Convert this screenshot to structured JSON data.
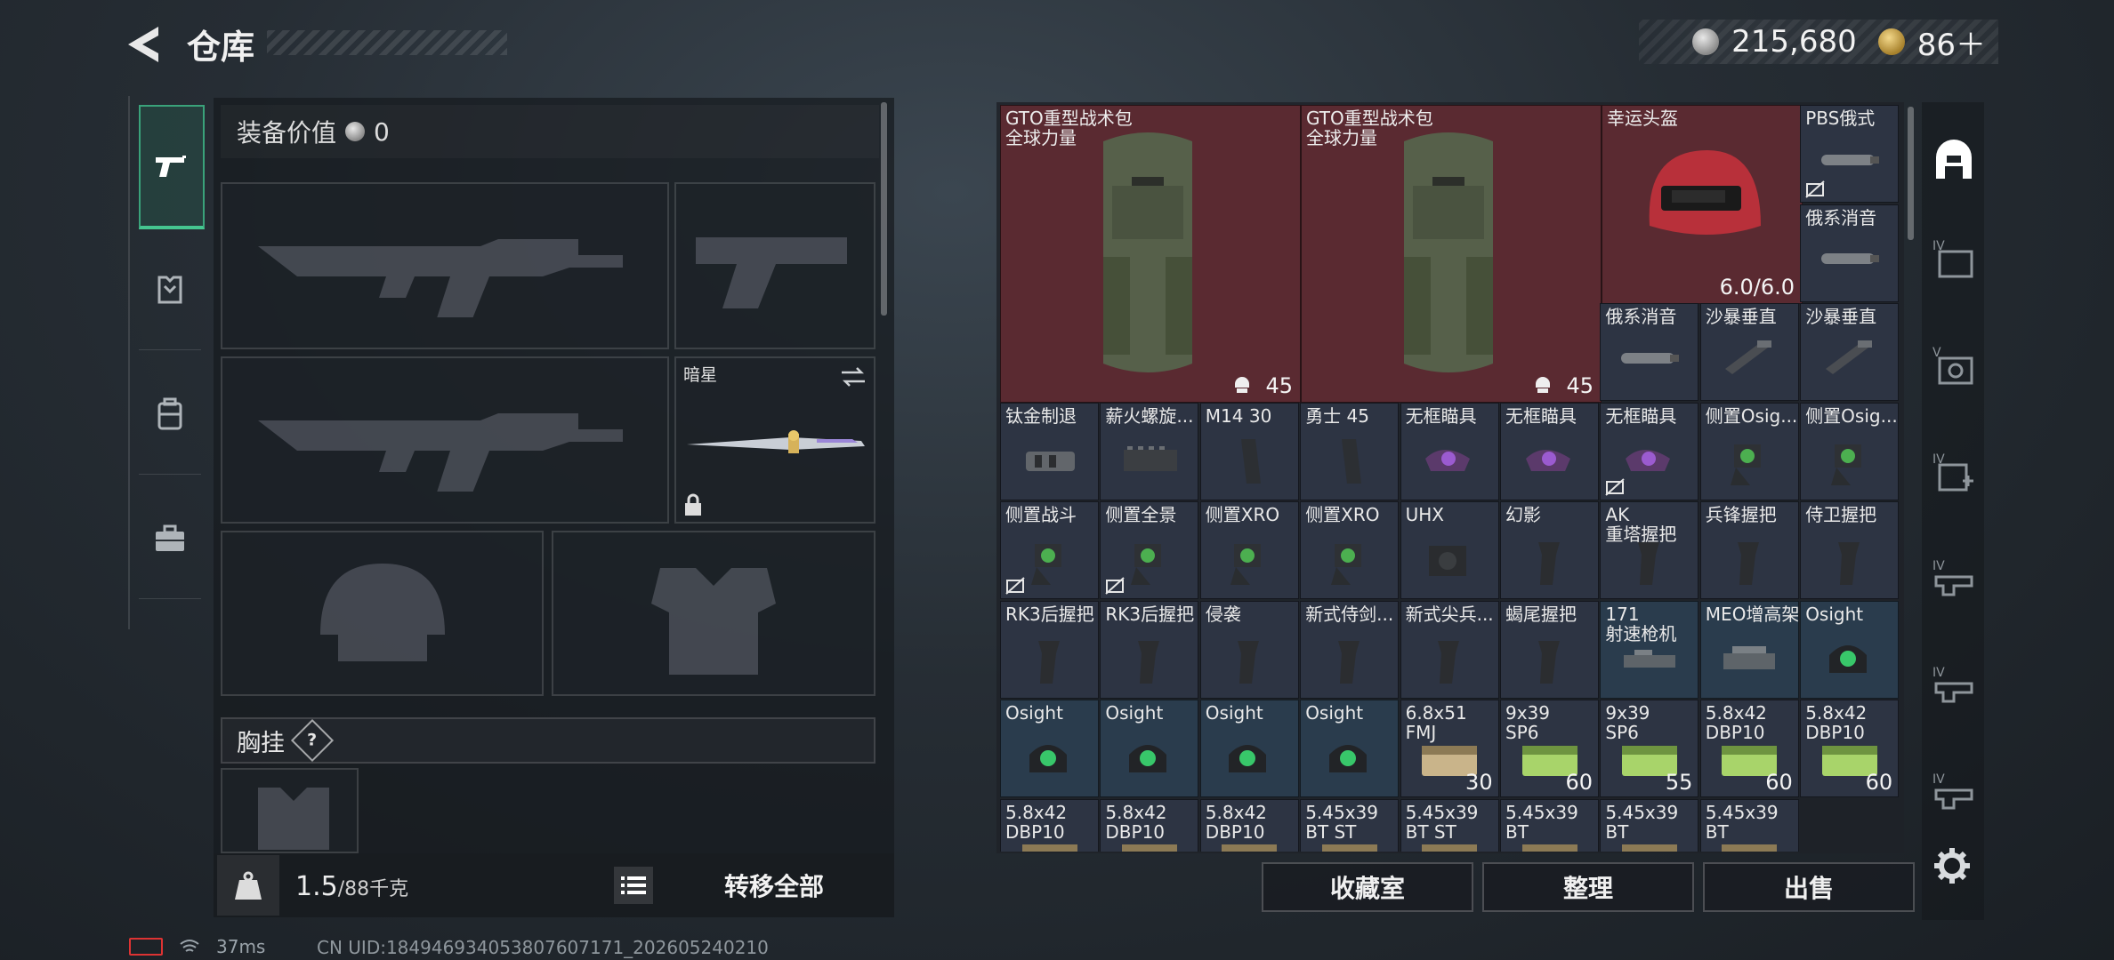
{
  "header": {
    "title": "仓库",
    "currency_silver": "215,680",
    "currency_gold": "86＋"
  },
  "equip": {
    "value_label": "装备价值",
    "value_amount": "0",
    "knife_label": "暗星",
    "chest_label": "胸挂",
    "help_symbol": "?"
  },
  "weight": {
    "current": "1.5",
    "max": "/88千克"
  },
  "transfer_all": "转移全部",
  "big_items": [
    {
      "name": "GTO重型战术包\n全球力量",
      "count": "45"
    },
    {
      "name": "GTO重型战术包\n全球力量",
      "count": "45"
    },
    {
      "name": "幸运头盔",
      "durability": "6.0/6.0"
    }
  ],
  "grid": [
    {
      "name": "PBS俄式",
      "count": "",
      "bg": "normal",
      "icon": "suppressor",
      "locked": true
    },
    {
      "name": "俄系消音",
      "count": "",
      "bg": "normal",
      "icon": "suppressor"
    },
    {
      "name": "俄系消音",
      "count": "",
      "bg": "normal",
      "icon": "suppressor"
    },
    {
      "name": "沙暴垂直",
      "count": "",
      "bg": "normal",
      "icon": "grip"
    },
    {
      "name": "沙暴垂直",
      "count": "",
      "bg": "normal",
      "icon": "grip"
    },
    {
      "name": "钛金制退",
      "count": "",
      "bg": "normal",
      "icon": "brake"
    },
    {
      "name": "薪火螺旋...",
      "count": "",
      "bg": "normal",
      "icon": "rail"
    },
    {
      "name": "M14 30",
      "count": "",
      "bg": "normal",
      "icon": "mag"
    },
    {
      "name": "勇士 45",
      "count": "",
      "bg": "normal",
      "icon": "mag"
    },
    {
      "name": "无框瞄具",
      "count": "",
      "bg": "normal",
      "icon": "reddot"
    },
    {
      "name": "无框瞄具",
      "count": "",
      "bg": "normal",
      "icon": "reddot"
    },
    {
      "name": "无框瞄具",
      "count": "",
      "bg": "normal",
      "icon": "reddot",
      "locked": true
    },
    {
      "name": "侧置Osig...",
      "count": "",
      "bg": "normal",
      "icon": "sight"
    },
    {
      "name": "侧置Osig...",
      "count": "",
      "bg": "normal",
      "icon": "sight"
    },
    {
      "name": "侧置战斗",
      "count": "",
      "bg": "normal",
      "icon": "sight",
      "locked": true
    },
    {
      "name": "侧置全景",
      "count": "",
      "bg": "normal",
      "icon": "sight",
      "locked": true
    },
    {
      "name": "侧置XRO",
      "count": "",
      "bg": "normal",
      "icon": "sight"
    },
    {
      "name": "侧置XRO",
      "count": "",
      "bg": "normal",
      "icon": "sight"
    },
    {
      "name": "UHX",
      "count": "",
      "bg": "normal",
      "icon": "holo"
    },
    {
      "name": "幻影",
      "count": "",
      "bg": "normal",
      "icon": "pgrip"
    },
    {
      "name": "AK\n重塔握把",
      "count": "",
      "bg": "normal",
      "icon": "pgrip"
    },
    {
      "name": "兵锋握把",
      "count": "",
      "bg": "normal",
      "icon": "pgrip"
    },
    {
      "name": "侍卫握把",
      "count": "",
      "bg": "normal",
      "icon": "pgrip"
    },
    {
      "name": "RK3后握把",
      "count": "",
      "bg": "normal",
      "icon": "pgrip"
    },
    {
      "name": "RK3后握把",
      "count": "",
      "bg": "normal",
      "icon": "pgrip"
    },
    {
      "name": "侵袭",
      "count": "",
      "bg": "normal",
      "icon": "pgrip"
    },
    {
      "name": "新式侍剑...",
      "count": "",
      "bg": "normal",
      "icon": "pgrip"
    },
    {
      "name": "新式尖兵...",
      "count": "",
      "bg": "normal",
      "icon": "pgrip"
    },
    {
      "name": "蝎尾握把",
      "count": "",
      "bg": "normal",
      "icon": "pgrip"
    },
    {
      "name": "171\n射速枪机",
      "count": "",
      "bg": "blue",
      "icon": "bolt"
    },
    {
      "name": "MEO增高架",
      "count": "",
      "bg": "blue",
      "icon": "mount"
    },
    {
      "name": "Osight",
      "count": "",
      "bg": "blue",
      "icon": "osight"
    },
    {
      "name": "Osight",
      "count": "",
      "bg": "blue",
      "icon": "osight"
    },
    {
      "name": "Osight",
      "count": "",
      "bg": "blue",
      "icon": "osight"
    },
    {
      "name": "Osight",
      "count": "",
      "bg": "blue",
      "icon": "osight"
    },
    {
      "name": "Osight",
      "count": "",
      "bg": "blue",
      "icon": "osight"
    },
    {
      "name": "6.8x51\nFMJ",
      "count": "30",
      "bg": "normal",
      "icon": "ammo_tan"
    },
    {
      "name": "9x39\nSP6",
      "count": "60",
      "bg": "normal",
      "icon": "ammo_green"
    },
    {
      "name": "9x39\nSP6",
      "count": "55",
      "bg": "normal",
      "icon": "ammo_green"
    },
    {
      "name": "5.8x42\nDBP10",
      "count": "60",
      "bg": "normal",
      "icon": "ammo_green"
    },
    {
      "name": "5.8x42\nDBP10",
      "count": "60",
      "bg": "normal",
      "icon": "ammo_green"
    },
    {
      "name": "5.8x42\nDBP10",
      "count": "",
      "bg": "normal",
      "icon": "ammo_tan"
    },
    {
      "name": "5.8x42\nDBP10",
      "count": "",
      "bg": "normal",
      "icon": "ammo_tan"
    },
    {
      "name": "5.8x42\nDBP10",
      "count": "",
      "bg": "normal",
      "icon": "ammo_tan"
    },
    {
      "name": "5.45x39\nBT ST",
      "count": "",
      "bg": "normal",
      "icon": "ammo_tan"
    },
    {
      "name": "5.45x39\nBT ST",
      "count": "",
      "bg": "normal",
      "icon": "ammo_tan"
    },
    {
      "name": "5.45x39\nBT",
      "count": "",
      "bg": "normal",
      "icon": "ammo_tan"
    },
    {
      "name": "5.45x39\nBT",
      "count": "",
      "bg": "normal",
      "icon": "ammo_tan"
    },
    {
      "name": "5.45x39\nBT",
      "count": "",
      "bg": "normal",
      "icon": "ammo_tan"
    }
  ],
  "buttons": {
    "collection": "收藏室",
    "sort": "整理",
    "sell": "出售"
  },
  "status": {
    "ping": "37ms",
    "uid": "CN UID:184946934053807607171_202605240210"
  },
  "colors": {
    "accent_green": "#45c690",
    "item_red": "#5a2a31",
    "item_blue": "#2a3c4d",
    "item_normal": "#2d3443"
  }
}
